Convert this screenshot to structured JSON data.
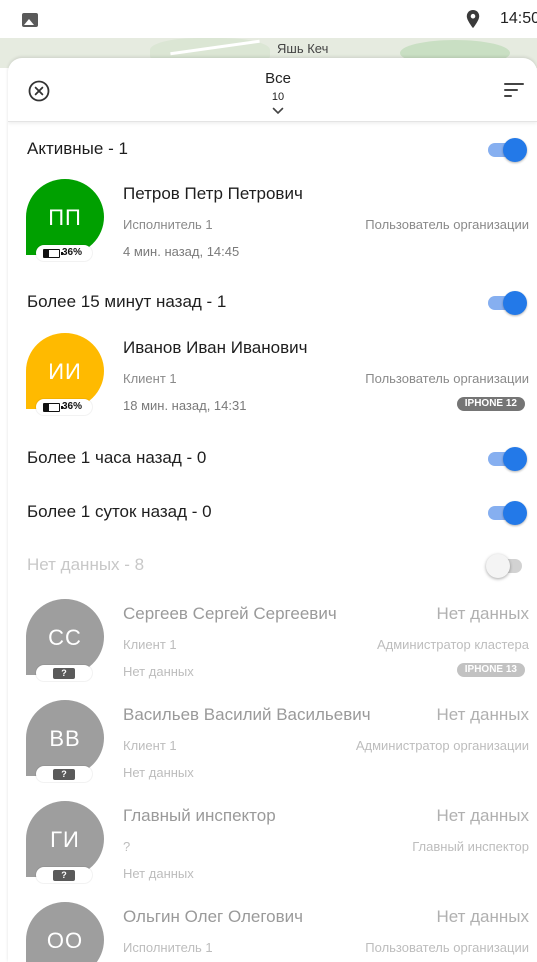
{
  "status_bar": {
    "time": "14:50"
  },
  "map": {
    "label": "Яшь Кеч"
  },
  "header": {
    "filter_title": "Все",
    "filter_count": "10"
  },
  "colors": {
    "accent": "#2379e8",
    "green": "#00a000",
    "yellow": "#ffba00",
    "gray": "#9e9e9e"
  },
  "groups": [
    {
      "label": "Активные - 1",
      "enabled": true
    },
    {
      "label": "Более 15 минут назад - 1",
      "enabled": true
    },
    {
      "label": "Более 1 часа назад - 0",
      "enabled": true
    },
    {
      "label": "Более 1 суток назад - 0",
      "enabled": true
    },
    {
      "label": "Нет данных - 8",
      "enabled": false
    }
  ],
  "people": [
    {
      "initials": "ПП",
      "name": "Петров Петр Петрович",
      "status": "",
      "sub": "Исполнитель 1",
      "role": "Пользователь организации",
      "time": "4 мин. назад, 14:45",
      "device": "",
      "battery": "36%",
      "battery_level": 0.36,
      "color": "#00a000"
    },
    {
      "initials": "ИИ",
      "name": "Иванов Иван Иванович",
      "status": "",
      "sub": "Клиент 1",
      "role": "Пользователь организации",
      "time": "18 мин. назад, 14:31",
      "device": "IPHONE 12",
      "battery": "36%",
      "battery_level": 0.36,
      "color": "#ffba00"
    },
    {
      "initials": "СС",
      "name": "Сергеев Сергей Сергеевич",
      "status": "Нет данных",
      "sub": "Клиент 1",
      "role": "Администратор кластера",
      "time": "Нет данных",
      "device": "IPHONE 13",
      "battery": "?",
      "color": "#9e9e9e"
    },
    {
      "initials": "ВВ",
      "name": "Васильев Василий Васильевич",
      "status": "Нет данных",
      "sub": "Клиент 1",
      "role": "Администратор организации",
      "time": "Нет данных",
      "device": "",
      "battery": "?",
      "color": "#9e9e9e"
    },
    {
      "initials": "ГИ",
      "name": "Главный инспектор",
      "status": "Нет данных",
      "sub": "?",
      "role": "Главный инспектор",
      "time": "Нет данных",
      "device": "",
      "battery": "?",
      "color": "#9e9e9e"
    },
    {
      "initials": "ОО",
      "name": "Ольгин Олег Олегович",
      "status": "Нет данных",
      "sub": "Исполнитель 1",
      "role": "Пользователь организации",
      "time": "",
      "device": "",
      "battery": "",
      "color": "#9e9e9e"
    }
  ]
}
